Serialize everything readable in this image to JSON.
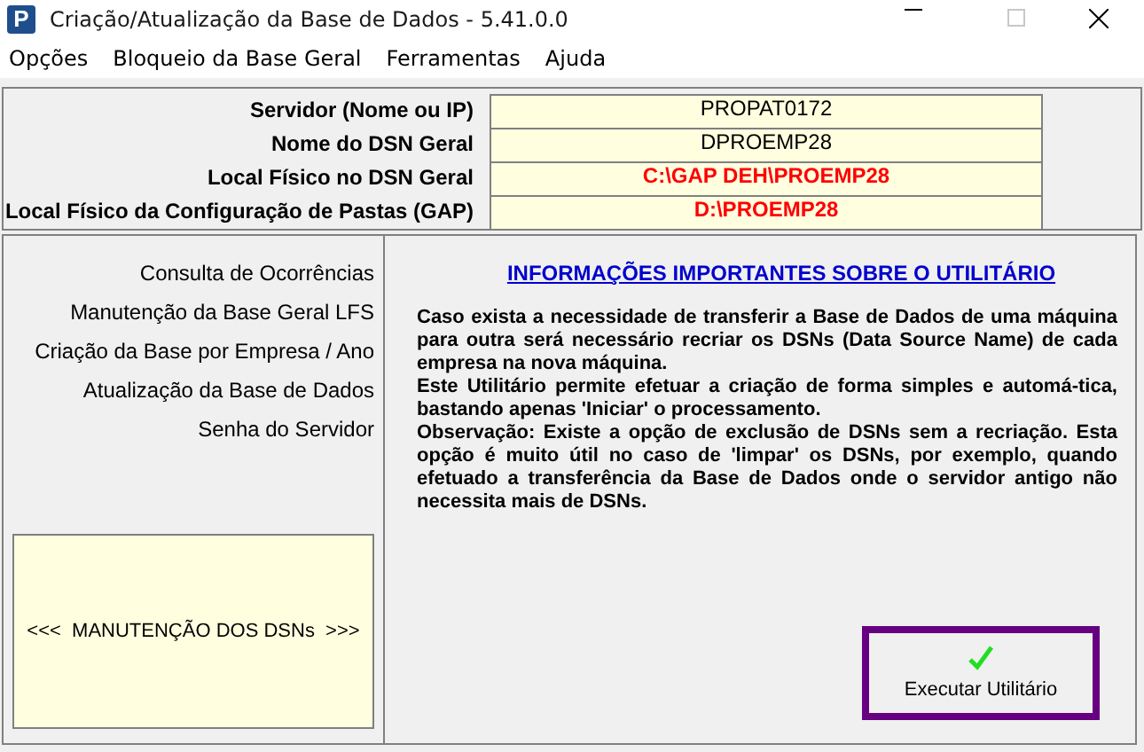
{
  "window": {
    "title": "Criação/Atualização da Base de Dados - 5.41.0.0",
    "logo": "P",
    "maximize_disabled": true
  },
  "menu": [
    "Opções",
    "Bloqueio da Base Geral",
    "Ferramentas",
    "Ajuda"
  ],
  "fields": [
    {
      "label": "Servidor (Nome ou IP)",
      "value": "PROPAT0172",
      "color": "#000000"
    },
    {
      "label": "Nome do DSN Geral",
      "value": "DPROEMP28",
      "color": "#000000"
    },
    {
      "label": "Local Físico no DSN Geral",
      "value": "C:\\GAP DEH\\PROEMP28",
      "color": "#ff0000"
    },
    {
      "label": "Local Físico da Configuração de Pastas (GAP)",
      "value": "D:\\PROEMP28",
      "color": "#ff0000"
    }
  ],
  "side_menu": [
    "Consulta de Ocorrências",
    "Manutenção da Base Geral LFS",
    "Criação da Base por Empresa / Ano",
    "Atualização da Base de Dados",
    "Senha do Servidor"
  ],
  "dsn_panel": {
    "label": "<<<  MANUTENÇÃO DOS DSNs  >>>"
  },
  "info": {
    "title": "INFORMAÇÕES IMPORTANTES SOBRE O UTILITÁRIO",
    "paragraphs": [
      "Caso exista a necessidade de transferir a Base de Dados de uma máquina para outra será necessário recriar os DSNs (Data Source Name) de cada empresa na nova máquina.",
      "Este Utilitário permite efetuar  a  criação de forma simples e automá-tica, bastando apenas 'Iniciar' o processamento.",
      "Observação: Existe a opção de exclusão de DSNs sem a recriação. Esta opção é muito útil no  caso de  'limpar' os DSNs,  por exemplo, quando  efetuado a transferência da Base de Dados onde o servidor antigo não necessita mais de  DSNs."
    ]
  },
  "run_button": {
    "label": "Executar Utilitário"
  }
}
